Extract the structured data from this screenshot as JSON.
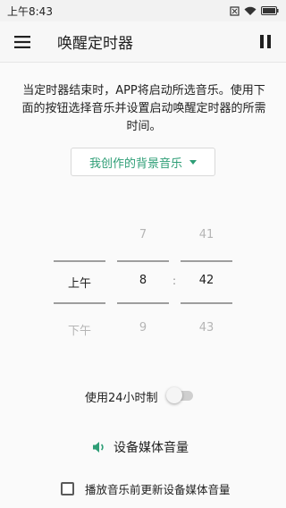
{
  "status_bar": {
    "time": "上午8:43",
    "battery_level": "full"
  },
  "app_bar": {
    "title": "唤醒定时器"
  },
  "description": "当定时器结束时，APP将启动所选音乐。使用下面的按钮选择音乐并设置启动唤醒定时器的所需时间。",
  "music_selector": {
    "selected": "我创作的背景音乐"
  },
  "time_picker": {
    "ampm": {
      "prev": "",
      "selected": "上午",
      "next": "下午"
    },
    "hour": {
      "prev": "7",
      "selected": "8",
      "next": "9"
    },
    "minute": {
      "prev": "41",
      "selected": "42",
      "next": "43"
    },
    "separator": ":"
  },
  "toggle_24h": {
    "label": "使用24小时制",
    "enabled": false
  },
  "volume": {
    "label": "设备媒体音量"
  },
  "update_volume_checkbox": {
    "label": "播放音乐前更新设备媒体音量",
    "checked": false
  },
  "colors": {
    "accent": "#2e9e76",
    "dim_text": "#b5b5b5",
    "picker_divider": "#9e9e9e"
  }
}
